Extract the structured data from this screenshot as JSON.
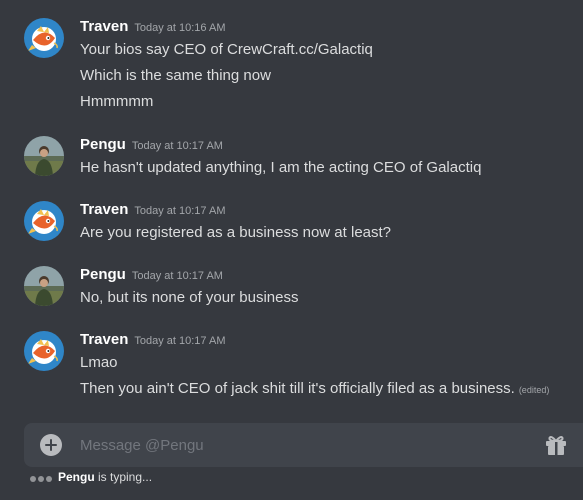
{
  "messages": [
    {
      "author": "Traven",
      "avatar_icon": "magikarp-avatar-icon",
      "timestamp": "Today at 10:16 AM",
      "lines": [
        "Your bios say CEO of CrewCraft.cc/Galactiq",
        "Which is the same thing now",
        "Hmmmmm"
      ]
    },
    {
      "author": "Pengu",
      "avatar_icon": "person-photo-avatar-icon",
      "timestamp": "Today at 10:17 AM",
      "lines": [
        "He hasn't updated anything, I am the acting CEO of Galactiq"
      ]
    },
    {
      "author": "Traven",
      "avatar_icon": "magikarp-avatar-icon",
      "timestamp": "Today at 10:17 AM",
      "lines": [
        "Are you registered as a business now at least?"
      ]
    },
    {
      "author": "Pengu",
      "avatar_icon": "person-photo-avatar-icon",
      "timestamp": "Today at 10:17 AM",
      "lines": [
        "No, but its none of your business"
      ]
    },
    {
      "author": "Traven",
      "avatar_icon": "magikarp-avatar-icon",
      "timestamp": "Today at 10:17 AM",
      "lines": [
        "Lmao",
        "Then you ain't CEO of jack shit till it's officially filed as a business."
      ],
      "edited_label": "(edited)"
    }
  ],
  "composer": {
    "placeholder": "Message @Pengu",
    "value": ""
  },
  "typing": {
    "user": "Pengu",
    "suffix": " is typing..."
  },
  "colors": {
    "background": "#36393f",
    "composer": "#40444b",
    "username": "#ffffff",
    "text": "#dcddde",
    "muted": "#a3a6aa",
    "traven_avatar_bg": "#2f86c8"
  }
}
